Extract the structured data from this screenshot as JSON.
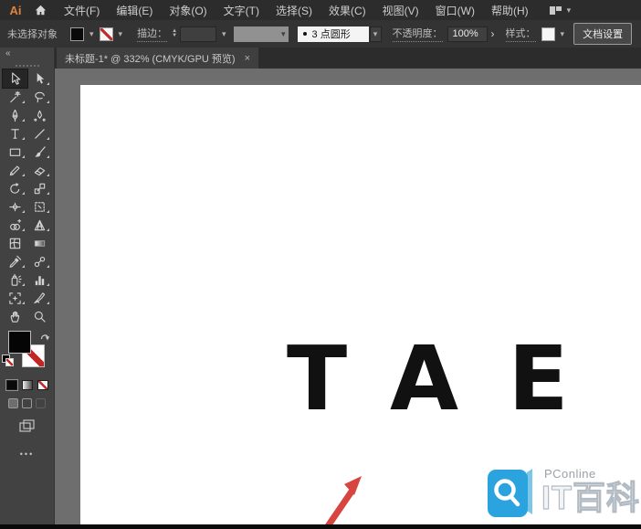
{
  "app": {
    "logo": "Ai"
  },
  "menu": {
    "items": [
      "文件(F)",
      "编辑(E)",
      "对象(O)",
      "文字(T)",
      "选择(S)",
      "效果(C)",
      "视图(V)",
      "窗口(W)",
      "帮助(H)"
    ]
  },
  "control": {
    "status": "未选择对象",
    "stroke_label": "描边：",
    "brush": "3 点圆形",
    "opacity_label": "不透明度：",
    "opacity": "100%",
    "style_label": "样式：",
    "doc_setup": "文档设置"
  },
  "tabs": {
    "active": {
      "title": "未标题-1* @ 332% (CMYK/GPU 预览)"
    }
  },
  "toolbar": {
    "tools": [
      "selection",
      "direct-selection",
      "magic-wand",
      "lasso",
      "pen",
      "curvature",
      "type",
      "line-segment",
      "rectangle",
      "paintbrush",
      "shaper",
      "eraser",
      "rotate",
      "scale",
      "width",
      "free-transform",
      "shape-builder",
      "perspective-grid",
      "mesh",
      "gradient",
      "eyedropper",
      "blend",
      "symbol-sprayer",
      "column-graph",
      "artboard",
      "slice",
      "hand",
      "zoom"
    ]
  },
  "icons": {
    "chevron_down": "▾",
    "stepper_up": "▲",
    "stepper_down": "▼",
    "flyout_right": "›",
    "close": "×",
    "collapse": "«",
    "more": "•••"
  },
  "canvas": {
    "artboard_text": "TAE"
  },
  "watermark": {
    "brand": "PConline",
    "title": "IT百科"
  },
  "colors": {
    "accent_red": "#d6453f",
    "logo_blue": "#2aa3df",
    "ai_orange": "#e0833e"
  }
}
